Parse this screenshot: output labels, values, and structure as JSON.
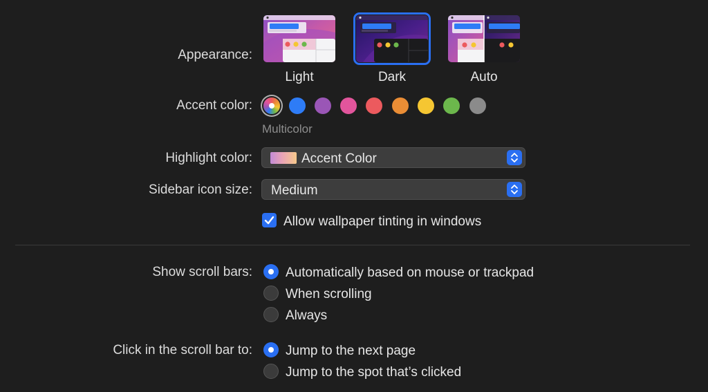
{
  "appearance": {
    "label": "Appearance:",
    "options": [
      {
        "label": "Light",
        "selected": false
      },
      {
        "label": "Dark",
        "selected": true
      },
      {
        "label": "Auto",
        "selected": false
      }
    ]
  },
  "accent": {
    "label": "Accent color:",
    "selected_name": "Multicolor",
    "colors": [
      {
        "name": "Multicolor",
        "hex": "multicolor"
      },
      {
        "name": "Blue",
        "hex": "#2e7cf6"
      },
      {
        "name": "Purple",
        "hex": "#9a56b6"
      },
      {
        "name": "Pink",
        "hex": "#e2559c"
      },
      {
        "name": "Red",
        "hex": "#ec5a5e"
      },
      {
        "name": "Orange",
        "hex": "#ea8d35"
      },
      {
        "name": "Yellow",
        "hex": "#f5c632"
      },
      {
        "name": "Green",
        "hex": "#6cb74c"
      },
      {
        "name": "Graphite",
        "hex": "#8b8b8b"
      }
    ]
  },
  "highlight": {
    "label": "Highlight color:",
    "value": "Accent Color"
  },
  "sidebar_icon_size": {
    "label": "Sidebar icon size:",
    "value": "Medium"
  },
  "wallpaper_tinting": {
    "label": "Allow wallpaper tinting in windows",
    "checked": true
  },
  "scroll_bars": {
    "label": "Show scroll bars:",
    "options": [
      {
        "label": "Automatically based on mouse or trackpad",
        "selected": true
      },
      {
        "label": "When scrolling",
        "selected": false
      },
      {
        "label": "Always",
        "selected": false
      }
    ]
  },
  "scroll_click": {
    "label": "Click in the scroll bar to:",
    "options": [
      {
        "label": "Jump to the next page",
        "selected": true
      },
      {
        "label": "Jump to the spot that’s clicked",
        "selected": false
      }
    ]
  },
  "colors": {
    "background": "#1e1e1e",
    "accent_blue": "#2a6ff2",
    "traffic_red": "#ec5a5e",
    "traffic_yellow": "#f5c632",
    "traffic_green": "#6cb74c"
  }
}
